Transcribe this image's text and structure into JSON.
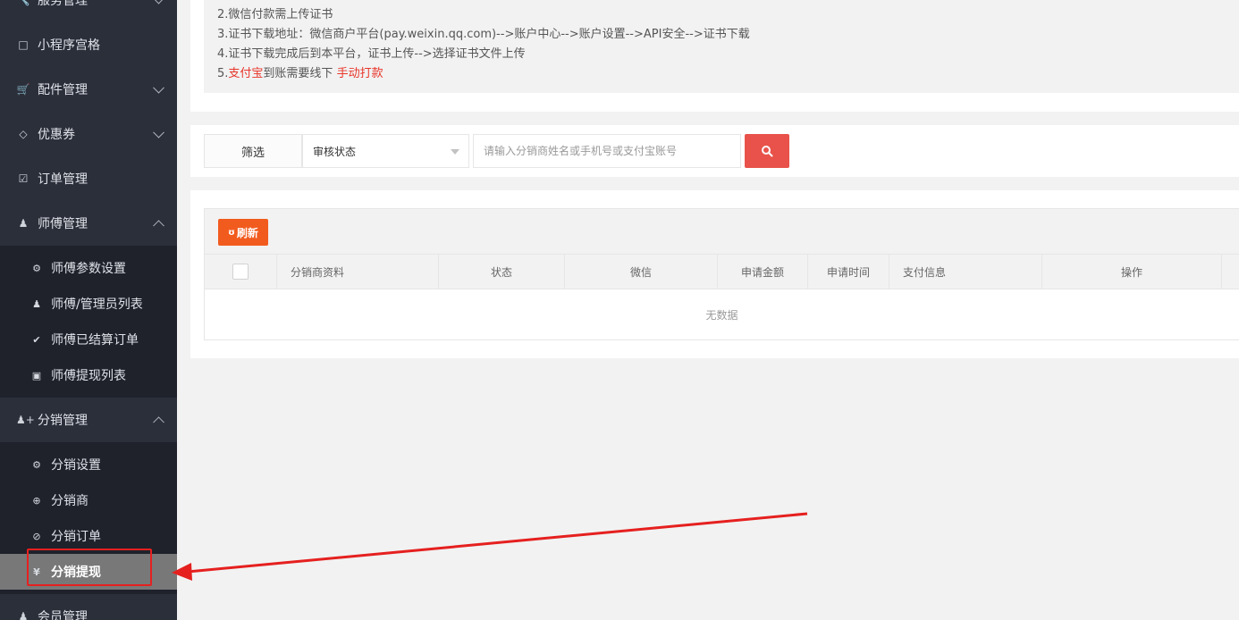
{
  "sidebar": {
    "top_item": {
      "label": "服务管理",
      "icon": "wrench-icon"
    },
    "items": [
      {
        "label": "小程序宫格",
        "icon": "square-icon"
      },
      {
        "label": "配件管理",
        "icon": "cart-icon"
      },
      {
        "label": "优惠券",
        "icon": "diamond-icon"
      },
      {
        "label": "订单管理",
        "icon": "check-square-icon"
      },
      {
        "label": "师傅管理",
        "icon": "worker-icon"
      }
    ],
    "master_sub": [
      {
        "label": "师傅参数设置",
        "icon": "gear-icon"
      },
      {
        "label": "师傅/管理员列表",
        "icon": "users-icon"
      },
      {
        "label": "师傅已结算订单",
        "icon": "check-circle-icon"
      },
      {
        "label": "师傅提现列表",
        "icon": "money-icon"
      }
    ],
    "distribution": {
      "label": "分销管理",
      "icon": "user-plus-icon"
    },
    "distribution_sub": [
      {
        "label": "分销设置",
        "icon": "gear-icon"
      },
      {
        "label": "分销商",
        "icon": "plus-circle-icon"
      },
      {
        "label": "分销订单",
        "icon": "check-circle-outline-icon"
      },
      {
        "label": "分销提现",
        "icon": "yen-icon",
        "icon_glyph": "¥"
      }
    ],
    "bottom_item": {
      "label": "会员管理",
      "icon": "user-icon"
    }
  },
  "notice": {
    "line2": "2.微信付款需上传证书",
    "line3": "3.证书下载地址：微信商户平台(pay.weixin.qq.com)-->账户中心-->账户设置-->API安全-->证书下载",
    "line4": "4.证书下载完成后到本平台，证书上传-->选择证书文件上传",
    "line5_prefix": "5.",
    "line5_red1": "支付宝",
    "line5_mid": "到账需要线下 ",
    "line5_red2": "手动打款"
  },
  "filter": {
    "label": "筛选",
    "select_value": "审核状态",
    "search_placeholder": "请输入分销商姓名或手机号或支付宝账号"
  },
  "table": {
    "refresh_label": "刷新",
    "refresh_icon": "ʊ",
    "columns": [
      "分销商资料",
      "状态",
      "微信",
      "申请金额",
      "申请时间",
      "支付信息",
      "操作"
    ],
    "empty_text": "无数据"
  },
  "colors": {
    "sidebar_bg": "#2b2f3a",
    "submenu_bg": "#1f222b",
    "active_item": "#787878",
    "accent_red": "#e8524a",
    "refresh_orange": "#f25b1e",
    "annotation_red": "#e5201f"
  }
}
